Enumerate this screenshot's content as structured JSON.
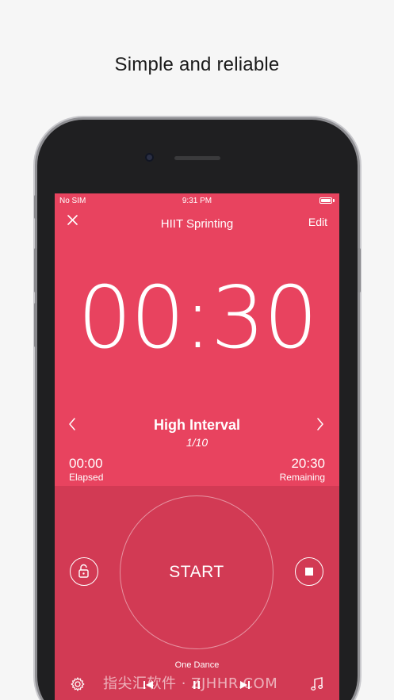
{
  "tagline": "Simple and reliable",
  "status_bar": {
    "carrier": "No SIM",
    "time": "9:31 PM"
  },
  "nav": {
    "title": "HIIT Sprinting",
    "edit_label": "Edit"
  },
  "timer": {
    "display": "00:30"
  },
  "interval": {
    "name": "High Interval",
    "count": "1/10"
  },
  "stats": {
    "elapsed_value": "00:00",
    "elapsed_label": "Elapsed",
    "remaining_value": "20:30",
    "remaining_label": "Remaining"
  },
  "controls": {
    "start_label": "START"
  },
  "music": {
    "song": "One Dance"
  },
  "watermark": "指尖汇软件 · ZJHHR.COM",
  "colors": {
    "accent": "#e8435f",
    "lower_panel": "#d23a54",
    "text": "#ffffff"
  },
  "icons": [
    "close-icon",
    "chevron-left-icon",
    "chevron-right-icon",
    "lock-icon",
    "stop-icon",
    "gear-icon",
    "previous-icon",
    "pause-icon",
    "next-icon",
    "music-note-icon",
    "battery-icon"
  ]
}
